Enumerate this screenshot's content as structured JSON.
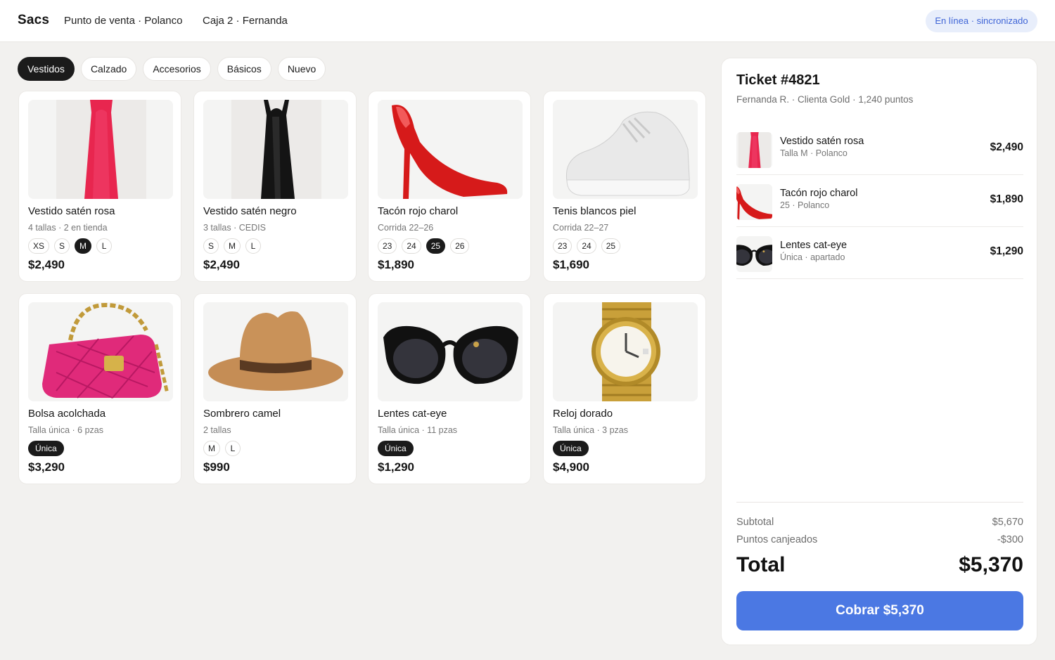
{
  "header": {
    "brand": "Sacs",
    "location": "Punto de venta · Polanco",
    "register": "Caja 2 · Fernanda",
    "status": "En línea · sincronizado"
  },
  "categories": [
    {
      "label": "Vestidos",
      "active": true
    },
    {
      "label": "Calzado",
      "active": false
    },
    {
      "label": "Accesorios",
      "active": false
    },
    {
      "label": "Básicos",
      "active": false
    },
    {
      "label": "Nuevo",
      "active": false
    }
  ],
  "products": [
    {
      "name": "Vestido satén rosa",
      "meta": "4 tallas · 2 en tienda",
      "sizes": [
        "XS",
        "S",
        "M",
        "L"
      ],
      "selected": "M",
      "price": "$2,490",
      "image": "dress-rosa"
    },
    {
      "name": "Vestido satén negro",
      "meta": "3 tallas · CEDIS",
      "sizes": [
        "S",
        "M",
        "L"
      ],
      "selected": "",
      "price": "$2,490",
      "image": "dress-negro"
    },
    {
      "name": "Tacón rojo charol",
      "meta": "Corrida 22–26",
      "sizes": [
        "23",
        "24",
        "25",
        "26"
      ],
      "selected": "25",
      "price": "$1,890",
      "image": "heel-red"
    },
    {
      "name": "Tenis blancos piel",
      "meta": "Corrida 22–27",
      "sizes": [
        "23",
        "24",
        "25"
      ],
      "selected": "",
      "price": "$1,690",
      "image": "sneaker-white"
    },
    {
      "name": "Bolsa acolchada",
      "meta": "Talla única · 6 pzas",
      "sizes": [
        "Única"
      ],
      "selected": "Única",
      "price": "$3,290",
      "image": "bag-pink"
    },
    {
      "name": "Sombrero camel",
      "meta": "2 tallas",
      "sizes": [
        "M",
        "L"
      ],
      "selected": "",
      "price": "$990",
      "image": "hat-camel"
    },
    {
      "name": "Lentes cat-eye",
      "meta": "Talla única · 11 pzas",
      "sizes": [
        "Única"
      ],
      "selected": "Única",
      "price": "$1,290",
      "image": "sunglasses"
    },
    {
      "name": "Reloj dorado",
      "meta": "Talla única · 3 pzas",
      "sizes": [
        "Única"
      ],
      "selected": "Única",
      "price": "$4,900",
      "image": "watch-gold"
    }
  ],
  "ticket": {
    "title": "Ticket #4821",
    "customer": "Fernanda R. · Clienta Gold · 1,240 puntos",
    "lines": [
      {
        "name": "Vestido satén rosa",
        "meta": "Talla M · Polanco",
        "price": "$2,490",
        "image": "dress-rosa"
      },
      {
        "name": "Tacón rojo charol",
        "meta": "25 · Polanco",
        "price": "$1,890",
        "image": "heel-red"
      },
      {
        "name": "Lentes cat-eye",
        "meta": "Única · apartado",
        "price": "$1,290",
        "image": "sunglasses"
      }
    ],
    "subtotal_label": "Subtotal",
    "subtotal": "$5,670",
    "points_label": "Puntos canjeados",
    "points": "-$300",
    "total_label": "Total",
    "total": "$5,370",
    "pay_label": "Cobrar $5,370"
  },
  "colors": {
    "accent": "#4b78e3",
    "status_text": "#3e64d6",
    "status_bg": "#e8eefb",
    "chip_active": "#1b1b1b",
    "background": "#f2f1ef"
  }
}
